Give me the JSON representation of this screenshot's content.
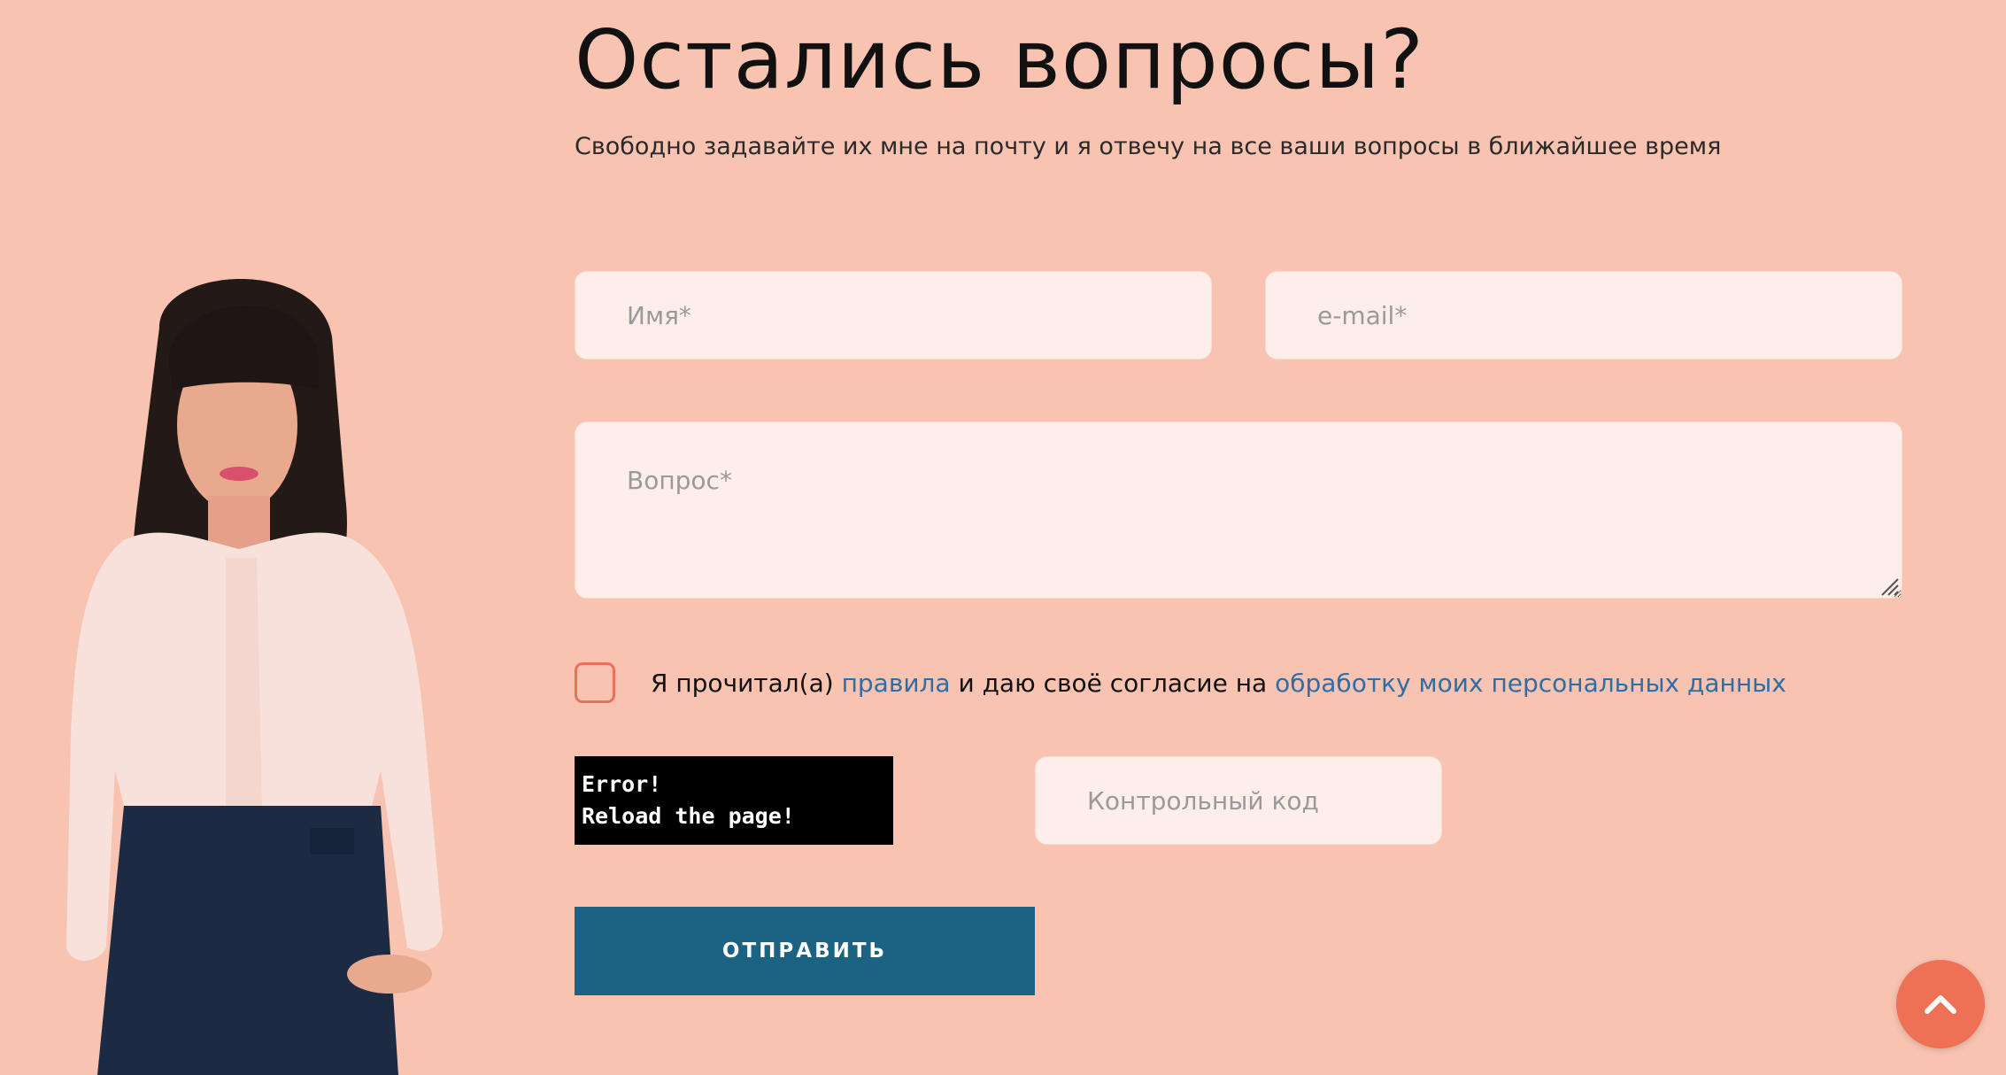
{
  "header": {
    "title": "Остались вопросы?",
    "subtitle": "Свободно задавайте их мне на почту и я отвечу на все ваши вопросы в ближайшее время"
  },
  "form": {
    "name_placeholder": "Имя*",
    "email_placeholder": "e-mail*",
    "question_placeholder": "Вопрос*",
    "consent": {
      "checked": false,
      "text_before": "Я прочитал(а) ",
      "rules_link": "правила",
      "text_middle": " и даю своё согласие на ",
      "privacy_link": "обработку моих персональных данных"
    },
    "captcha": {
      "line1": "Error!",
      "line2": "Reload the page!"
    },
    "code_placeholder": "Контрольный код",
    "submit_label": "ОТПРАВИТЬ"
  },
  "icons": {
    "scroll_top": "chevron-up-icon",
    "resize_grip": "resize-grip-icon"
  },
  "colors": {
    "background": "#f9c3b1",
    "input_background": "#fdeeea",
    "checkbox_border": "#e8715a",
    "link": "#2c6ea8",
    "submit_button": "#1b6283",
    "scroll_top_button": "#ee7055"
  }
}
